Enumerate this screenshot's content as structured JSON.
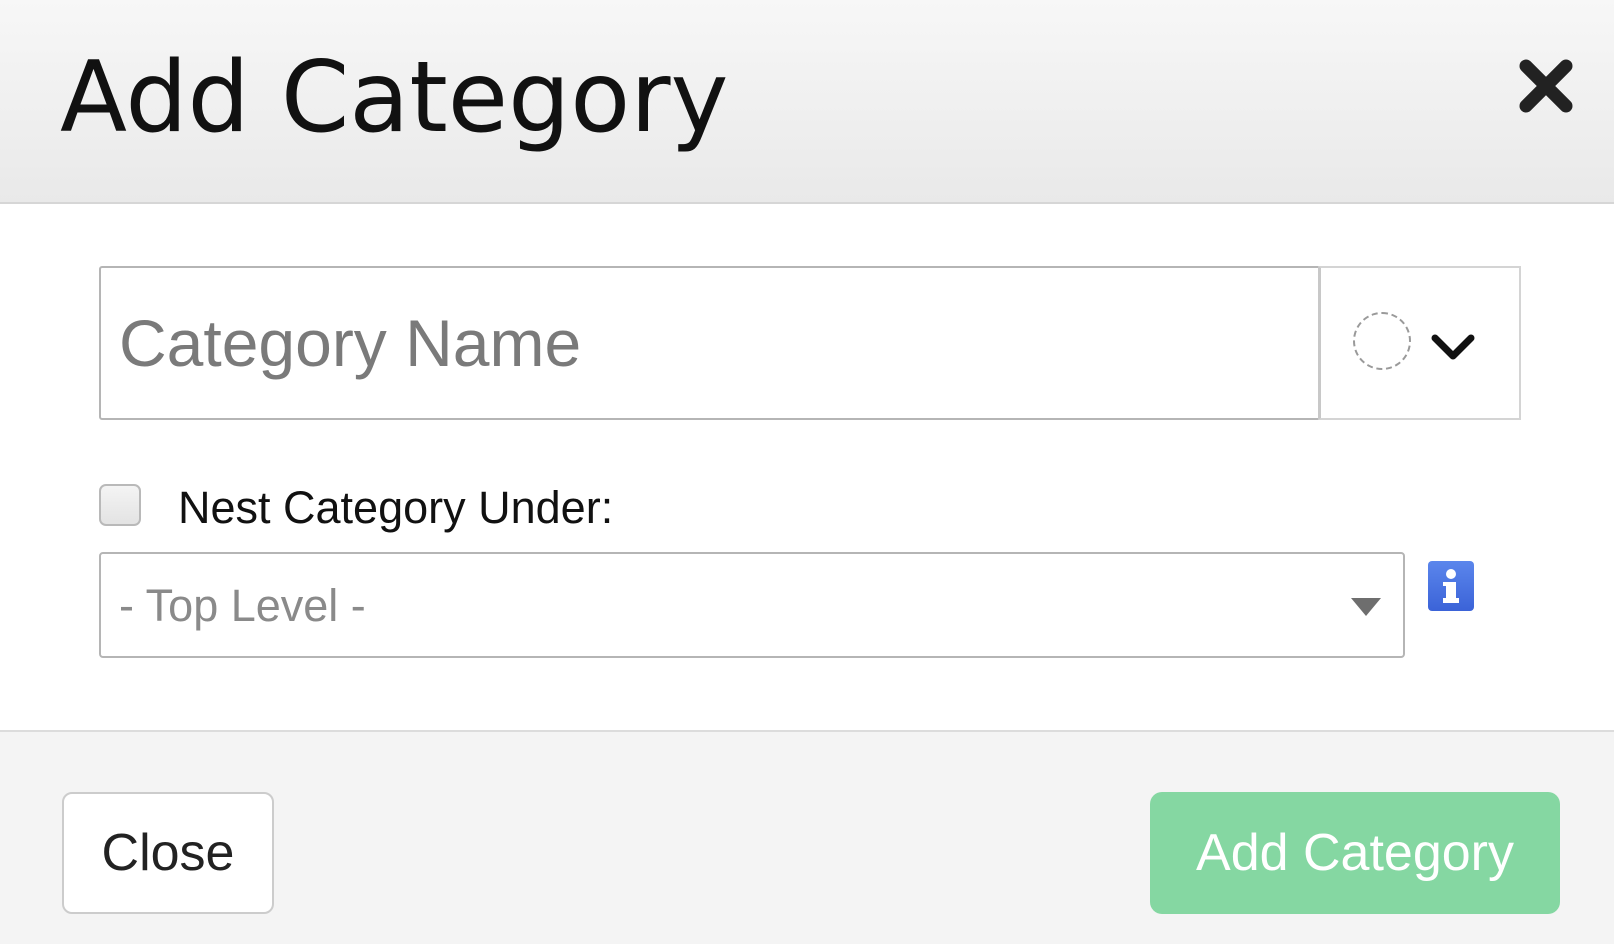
{
  "dialog": {
    "title": "Add Category"
  },
  "form": {
    "name_placeholder": "Category Name",
    "name_value": "",
    "nest_label": "Nest Category Under:",
    "nest_checked": false,
    "parent_selected": "- Top Level -"
  },
  "footer": {
    "close_label": "Close",
    "submit_label": "Add Category"
  },
  "icons": {
    "close": "close-icon",
    "chevron": "chevron-down-icon",
    "caret": "caret-down-icon",
    "info": "info-icon",
    "swatch": "color-swatch-empty"
  },
  "colors": {
    "submit_button": "#85d7a2",
    "info_button": "#3b63d8"
  }
}
